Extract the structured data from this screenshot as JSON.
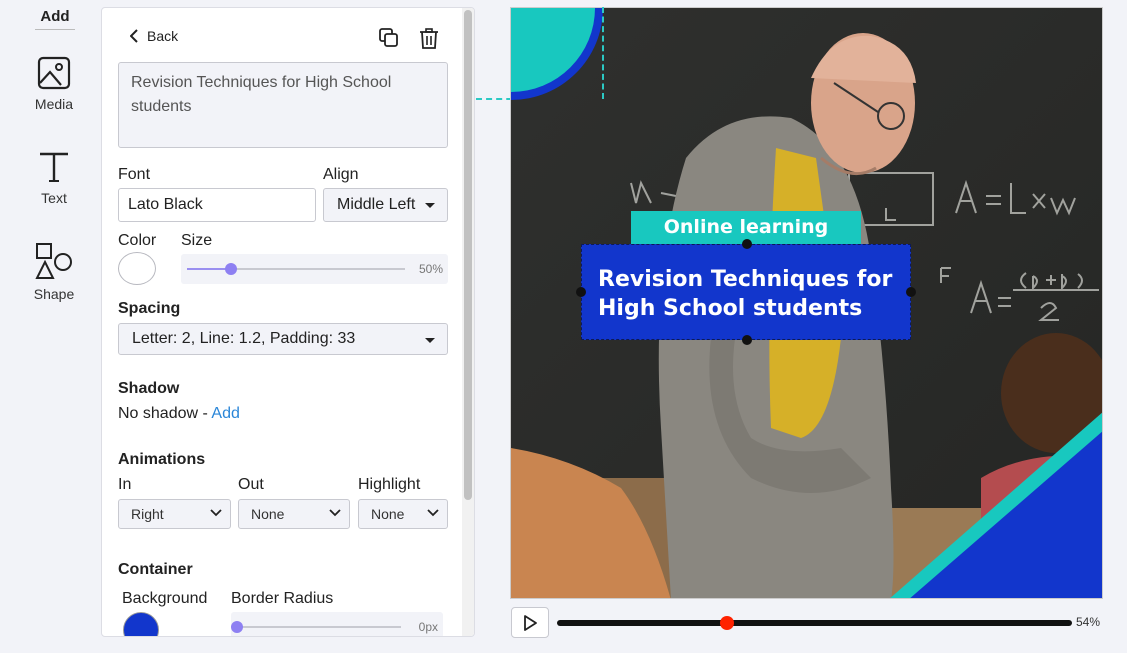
{
  "rail": {
    "title": "Add",
    "items": [
      {
        "label": "Media",
        "icon": "image-icon"
      },
      {
        "label": "Text",
        "icon": "text-t-icon"
      },
      {
        "label": "Shape",
        "icon": "shapes-icon"
      }
    ]
  },
  "panel": {
    "back_label": "Back",
    "text_value": "Revision Techniques for High School students",
    "font": {
      "label": "Font",
      "value": "Lato Black"
    },
    "align": {
      "label": "Align",
      "value": "Middle Left"
    },
    "color": {
      "label": "Color",
      "value": "#ffffff"
    },
    "size": {
      "label": "Size",
      "value": "50%",
      "fraction": 0.2
    },
    "spacing": {
      "label": "Spacing",
      "value": "Letter: 2, Line: 1.2, Padding: 33"
    },
    "shadow": {
      "label": "Shadow",
      "value": "No shadow - ",
      "add_label": "Add"
    },
    "animations": {
      "label": "Animations",
      "in": {
        "label": "In",
        "value": "Right"
      },
      "out": {
        "label": "Out",
        "value": "None"
      },
      "highlight": {
        "label": "Highlight",
        "value": "None"
      }
    },
    "container": {
      "label": "Container",
      "background": {
        "label": "Background",
        "value": "#1236cc"
      },
      "border_radius": {
        "label": "Border Radius",
        "value": "0px",
        "fraction": 0
      }
    }
  },
  "canvas": {
    "caption": "Online learning",
    "headline": "Revision Techniques for High School students",
    "colors": {
      "teal": "#18c8bf",
      "blue": "#1236cc"
    }
  },
  "player": {
    "progress_label": "54%",
    "progress": 0.33
  }
}
